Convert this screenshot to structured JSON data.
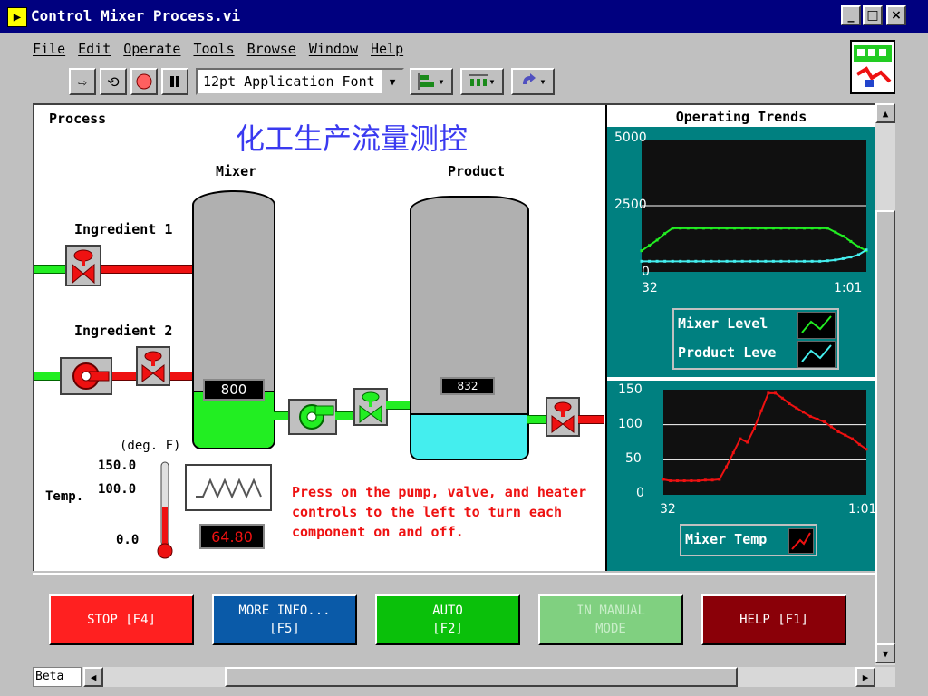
{
  "window": {
    "title": "Control Mixer Process.vi",
    "controls": {
      "minimize": "_",
      "maximize": "□",
      "close": "×"
    }
  },
  "menu": [
    "File",
    "Edit",
    "Operate",
    "Tools",
    "Browse",
    "Window",
    "Help"
  ],
  "toolbar": {
    "font_select": "12pt Application Font",
    "icons": [
      "run-arrow-icon",
      "run-continuous-icon",
      "abort-icon",
      "pause-icon",
      "align-objects-icon",
      "distribute-objects-icon",
      "reorder-icon"
    ]
  },
  "process": {
    "section_label": "Process",
    "chinese_title": "化工生产流量测控",
    "mixer_label": "Mixer",
    "product_label": "Product",
    "ingredient1_label": "Ingredient 1",
    "ingredient2_label": "Ingredient 2",
    "mixer_level_display": "800",
    "product_level_display": "832",
    "mixer_level_fraction": 0.16,
    "product_level_fraction": 0.1664,
    "temp_unit": "(deg. F)",
    "temp_label": "Temp.",
    "temp_scale": [
      "150.0",
      "100.0",
      "0.0"
    ],
    "temp_value": "64.80",
    "hint": "Press on the pump, valve, and heater controls to the left to turn each component on and off.",
    "colors": {
      "pipe_on": "#22ee22",
      "pipe_off": "#ee1111",
      "mixer_fill": "#22ee22",
      "product_fill": "#44eeee",
      "valve": "#ee1111"
    }
  },
  "trends": {
    "title": "Operating Trends",
    "top_chart": {
      "y_ticks": [
        "5000",
        "2500",
        "0"
      ],
      "x_ticks": [
        "32",
        "1:01"
      ],
      "legend": [
        "Mixer Level",
        "Product Level"
      ],
      "legend_visible": [
        "Mixer Level",
        "Product Leve"
      ]
    },
    "bottom_chart": {
      "y_ticks": [
        "150",
        "100",
        "50",
        "0"
      ],
      "x_ticks": [
        "32",
        "1:01"
      ],
      "legend": [
        "Mixer Temp"
      ]
    }
  },
  "chart_data": [
    {
      "type": "line",
      "title": "Operating Trends",
      "xlabel": "",
      "ylabel": "",
      "xlim": [
        32,
        61
      ],
      "ylim": [
        0,
        5000
      ],
      "x_tick_labels": [
        "32",
        "1:01"
      ],
      "grid": true,
      "legend": "bottom",
      "series": [
        {
          "name": "Mixer Level",
          "color": "#22ee22",
          "x": [
            32,
            33,
            34,
            35,
            36,
            37,
            38,
            39,
            40,
            41,
            42,
            43,
            44,
            45,
            46,
            47,
            48,
            49,
            50,
            51,
            52,
            53,
            54,
            55,
            56,
            57,
            58,
            59,
            60,
            61
          ],
          "y": [
            800,
            1000,
            1200,
            1450,
            1650,
            1650,
            1650,
            1650,
            1650,
            1650,
            1650,
            1650,
            1650,
            1650,
            1650,
            1650,
            1650,
            1650,
            1650,
            1650,
            1650,
            1650,
            1650,
            1650,
            1650,
            1500,
            1350,
            1150,
            950,
            800
          ]
        },
        {
          "name": "Product Level",
          "color": "#44eeee",
          "x": [
            32,
            33,
            34,
            35,
            36,
            37,
            38,
            39,
            40,
            41,
            42,
            43,
            44,
            45,
            46,
            47,
            48,
            49,
            50,
            51,
            52,
            53,
            54,
            55,
            56,
            57,
            58,
            59,
            60,
            61
          ],
          "y": [
            400,
            400,
            400,
            400,
            400,
            400,
            400,
            400,
            400,
            400,
            400,
            400,
            400,
            400,
            400,
            400,
            400,
            400,
            400,
            400,
            400,
            400,
            400,
            400,
            420,
            450,
            500,
            560,
            650,
            832
          ]
        }
      ]
    },
    {
      "type": "line",
      "title": "",
      "xlabel": "",
      "ylabel": "",
      "xlim": [
        32,
        61
      ],
      "ylim": [
        0,
        150
      ],
      "x_tick_labels": [
        "32",
        "1:01"
      ],
      "grid": true,
      "legend": "bottom",
      "series": [
        {
          "name": "Mixer Temp",
          "color": "#ee1111",
          "x": [
            32,
            33,
            34,
            35,
            36,
            37,
            38,
            39,
            40,
            41,
            42,
            43,
            44,
            45,
            46,
            47,
            48,
            49,
            50,
            51,
            52,
            53,
            54,
            55,
            56,
            57,
            58,
            59,
            60,
            61
          ],
          "y": [
            22,
            20,
            20,
            20,
            20,
            20,
            21,
            21,
            22,
            40,
            60,
            80,
            75,
            95,
            120,
            145,
            145,
            138,
            130,
            124,
            118,
            112,
            108,
            104,
            97,
            90,
            85,
            80,
            72,
            65
          ]
        }
      ]
    }
  ],
  "buttons": {
    "stop": {
      "label": "STOP [F4]",
      "color": "#ff2020"
    },
    "more_info": {
      "label": "MORE INFO...\n[F5]",
      "color": "#0a5aa8"
    },
    "auto": {
      "label": "AUTO\n[F2]",
      "color": "#0ac00a"
    },
    "manual": {
      "label": "IN MANUAL\nMODE",
      "color": "#80d080"
    },
    "help": {
      "label": "HELP [F1]",
      "color": "#8a0008"
    }
  },
  "status": {
    "beta": "Beta"
  }
}
